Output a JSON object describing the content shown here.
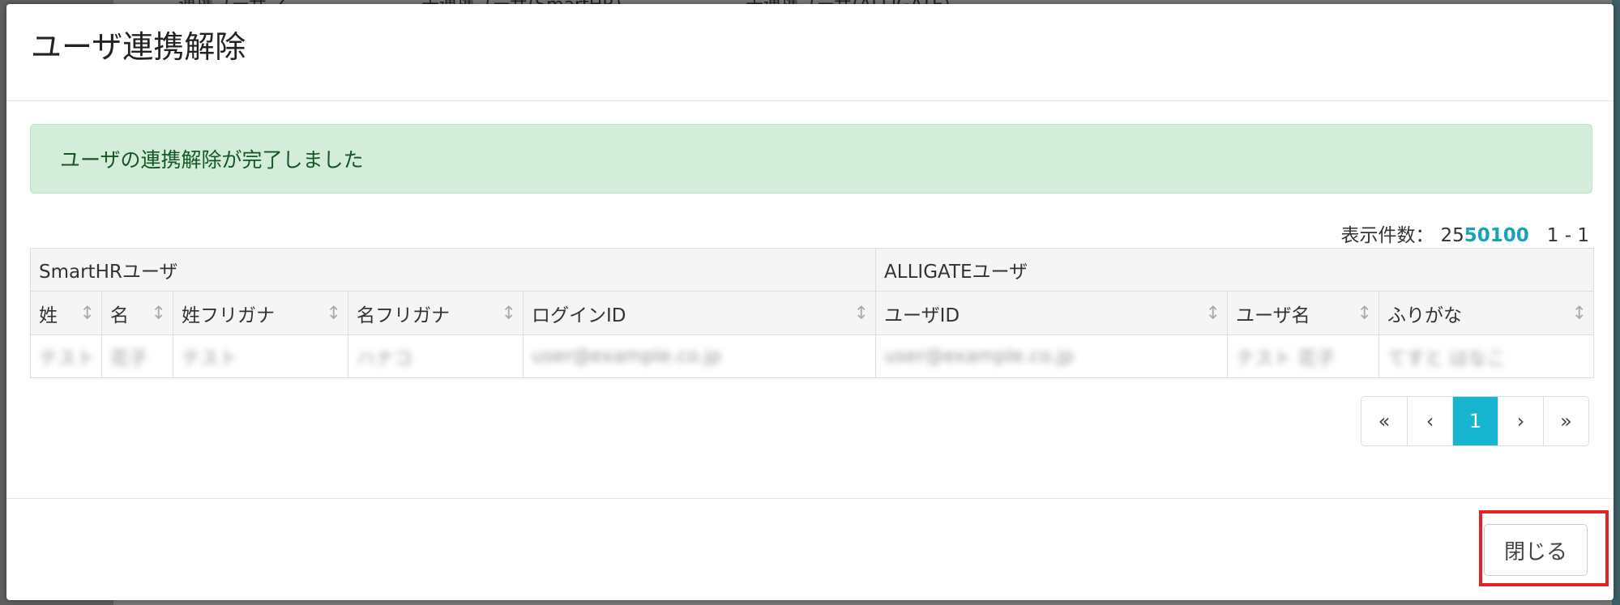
{
  "background": {
    "tabs": [
      "連携ユーザ ✓",
      "未連携ユーザ(SmartHR)",
      "未連携ユーザ(ALLIGATE)"
    ]
  },
  "modal": {
    "title": "ユーザ連携解除",
    "alert_message": "ユーザの連携解除が完了しました",
    "display_count": {
      "label": "表示件数：",
      "options": [
        "25",
        "50",
        "100"
      ],
      "selected": "25",
      "range": "1 - 1"
    },
    "table": {
      "groups": [
        "SmartHRユーザ",
        "ALLIGATEユーザ"
      ],
      "columns": [
        "姓",
        "名",
        "姓フリガナ",
        "名フリガナ",
        "ログインID",
        "ユーザID",
        "ユーザ名",
        "ふりがな"
      ],
      "sort_icon": "↕",
      "rows": [
        [
          "テスト",
          "花子",
          "テスト",
          "ハナコ",
          "user@example.co.jp",
          "user@example.co.jp",
          "テスト 花子",
          "てすと はなこ"
        ]
      ]
    },
    "pagination": {
      "first": "«",
      "prev": "‹",
      "current": "1",
      "next": "›",
      "last": "»"
    },
    "close_label": "閉じる"
  },
  "colors": {
    "accent": "#17b5cf",
    "alert_bg": "#d4edda",
    "alert_text": "#155724",
    "highlight": "#e32222"
  }
}
